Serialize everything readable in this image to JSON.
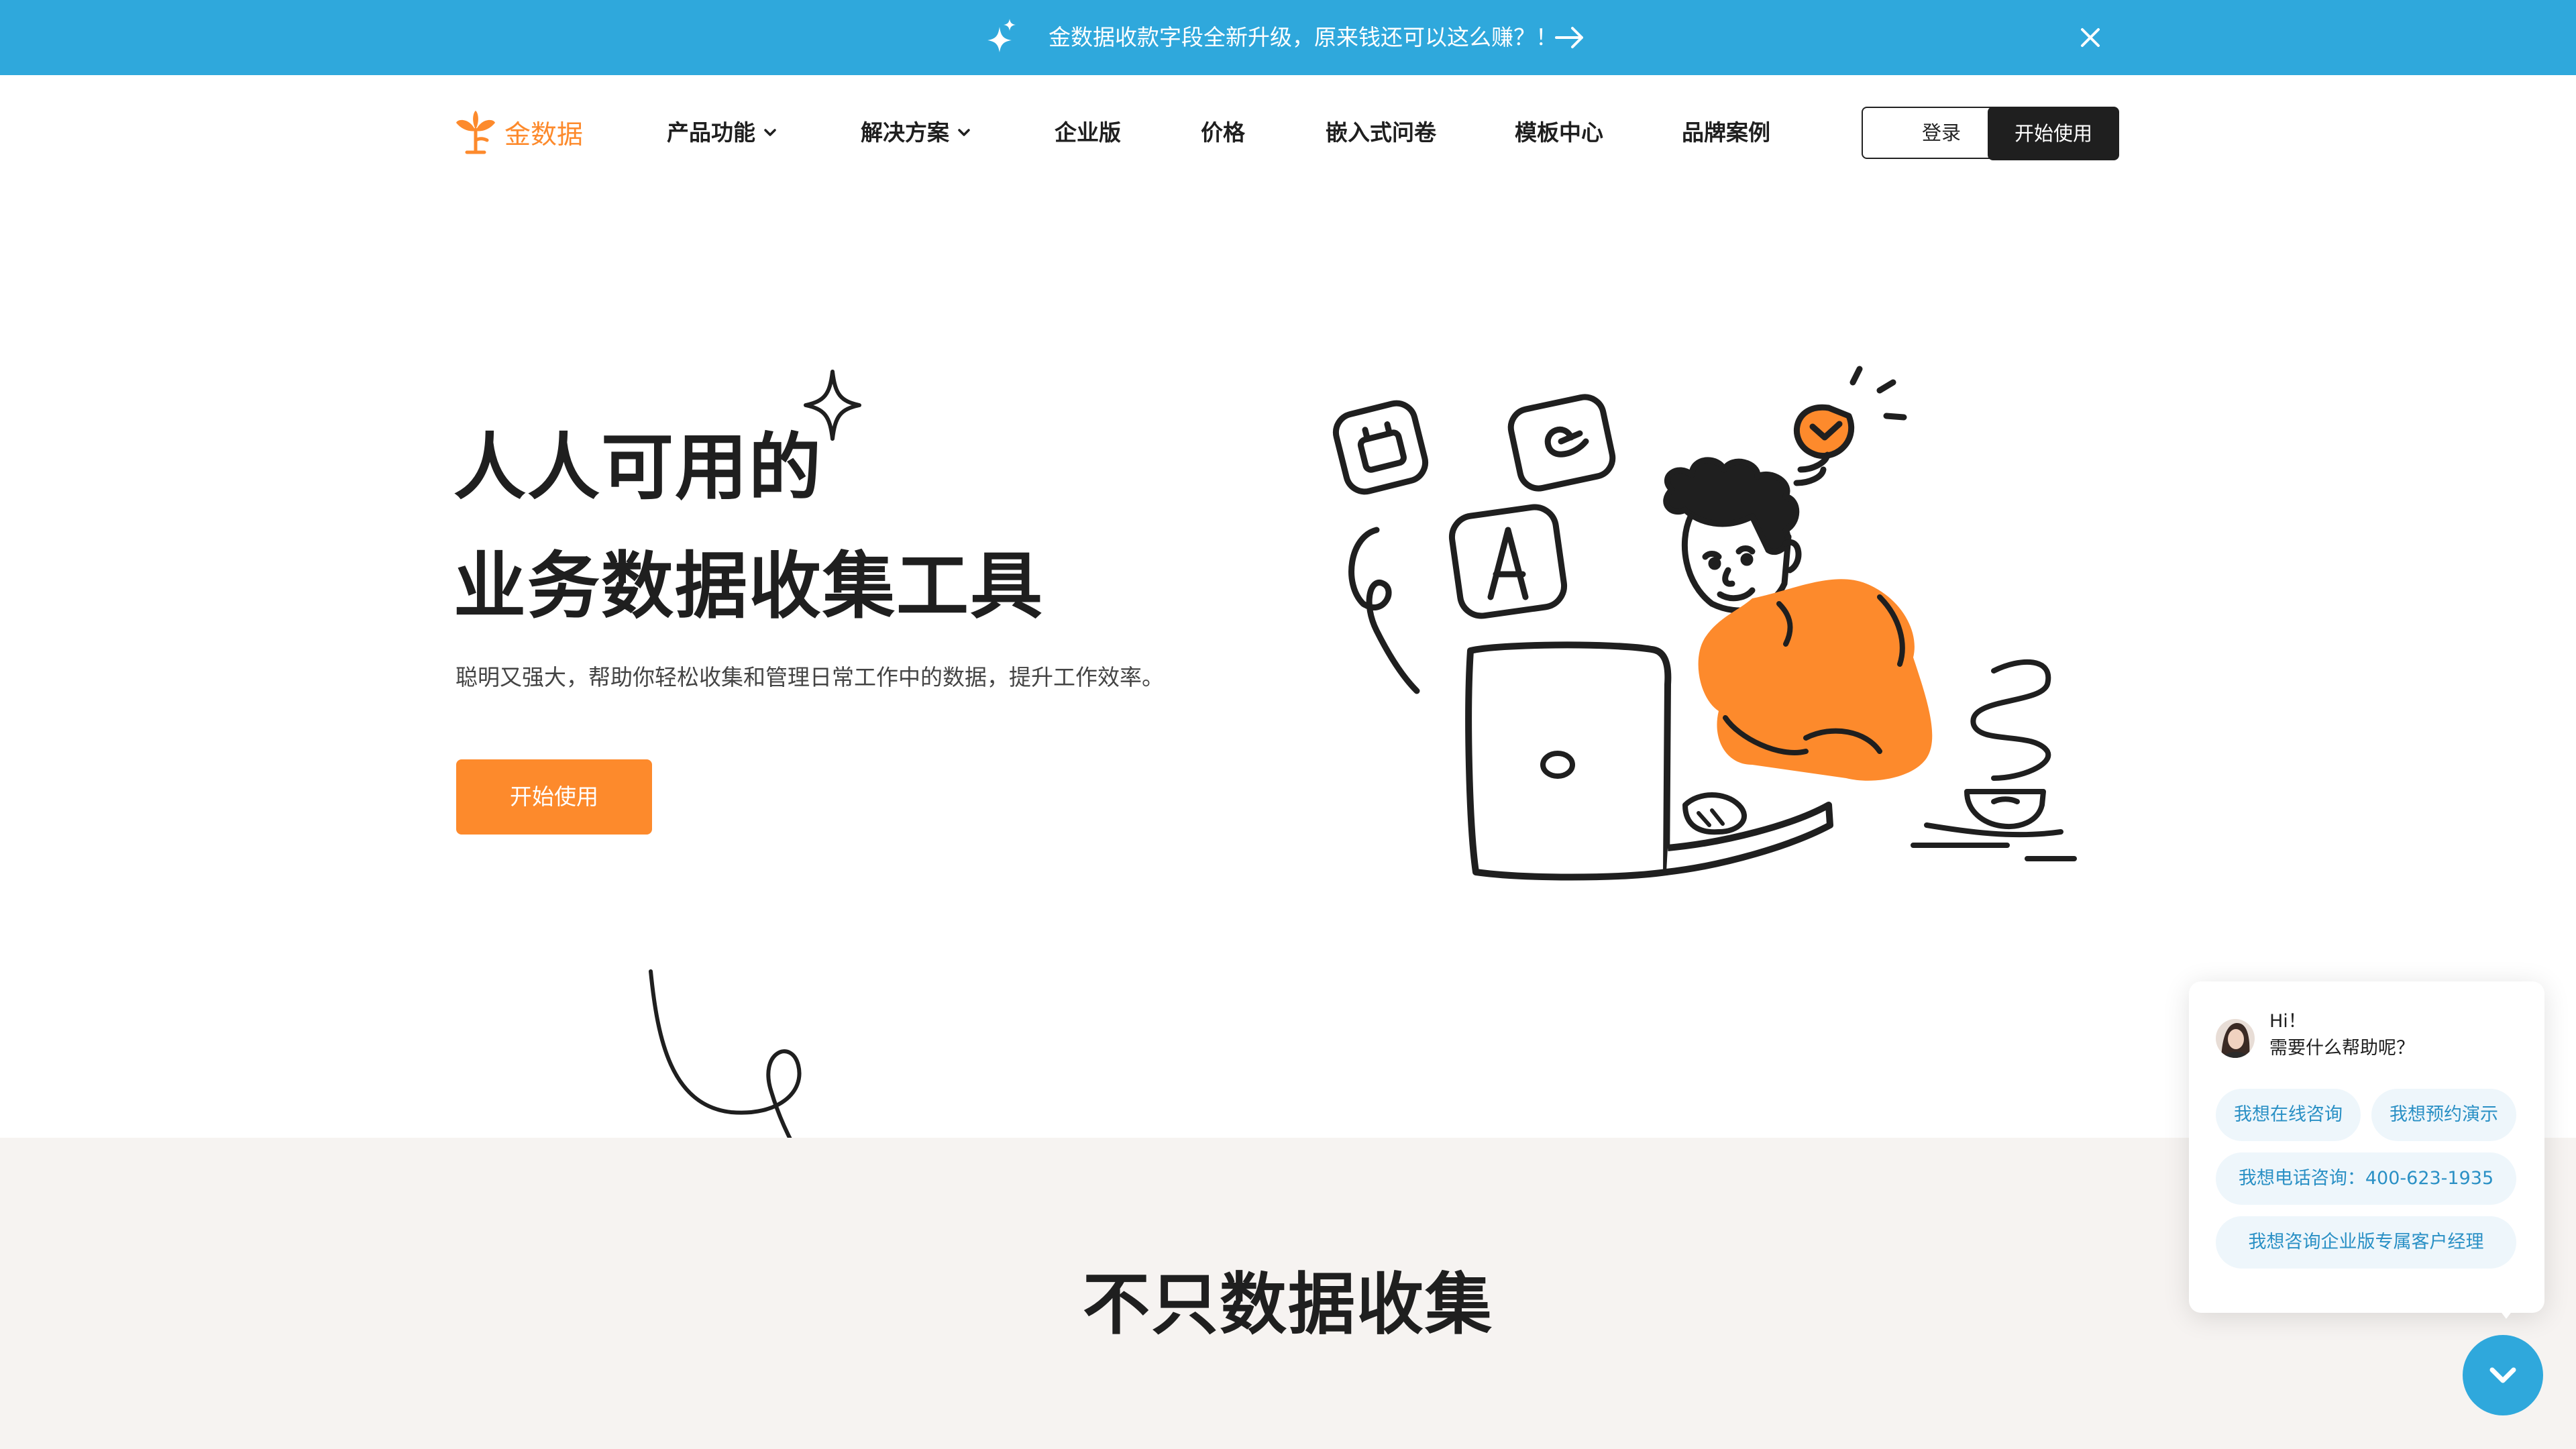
{
  "announcement": {
    "text": "金数据收款字段全新升级，原来钱还可以这么赚？！"
  },
  "brand": {
    "name": "金数据",
    "accent": "#fd8a2c",
    "blue": "#2fa8dc"
  },
  "nav": {
    "items": [
      {
        "label": "产品功能",
        "has_dropdown": true
      },
      {
        "label": "解决方案",
        "has_dropdown": true
      },
      {
        "label": "企业版",
        "has_dropdown": false
      },
      {
        "label": "价格",
        "has_dropdown": false
      },
      {
        "label": "嵌入式问卷",
        "has_dropdown": false
      },
      {
        "label": "模板中心",
        "has_dropdown": false
      },
      {
        "label": "品牌案例",
        "has_dropdown": false
      }
    ],
    "login_label": "登录",
    "start_label": "开始使用"
  },
  "hero": {
    "line1": "人人可用的",
    "line2": "业务数据收集工具",
    "subtitle": "聪明又强大，帮助你轻松收集和管理日常工作中的数据，提升工作效率。",
    "cta_label": "开始使用"
  },
  "section2": {
    "title": "不只数据收集"
  },
  "chat": {
    "greeting_line1": "Hi！",
    "greeting_line2": "需要什么帮助呢？",
    "options": [
      "我想在线咨询",
      "我想预约演示",
      "我想电话咨询：400-623-1935",
      "我想咨询企业版专属客户经理"
    ]
  }
}
